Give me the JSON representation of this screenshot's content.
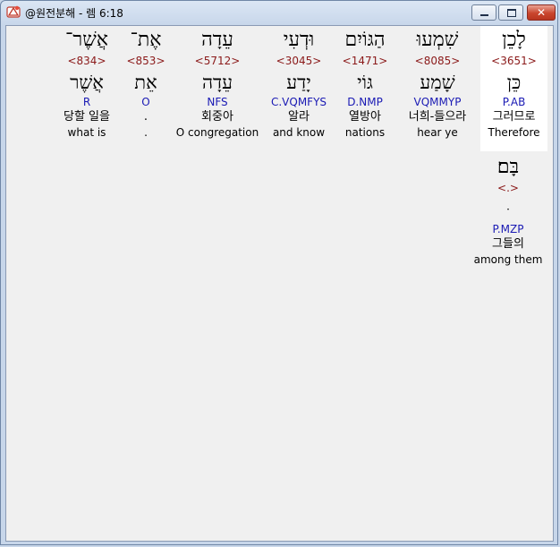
{
  "window": {
    "title": "@원전분해 - 렘 6:18",
    "close_glyph": "✕"
  },
  "words": [
    {
      "hebrew": "לָכֵן",
      "strong": "<3651>",
      "lemma": "כֵּן",
      "morph": "P.AB",
      "korean": "그러므로",
      "english": "Therefore",
      "selected": true
    },
    {
      "hebrew": "שִׁמְעוּ",
      "strong": "<8085>",
      "lemma": "שָׁמַע",
      "morph": "VQMMYP",
      "korean": "너희-들으라",
      "english": "hear ye",
      "selected": false
    },
    {
      "hebrew": "הַגּוֹיִם",
      "strong": "<1471>",
      "lemma": "גּוֹי",
      "morph": "D.NMP",
      "korean": "열방아",
      "english": "nations",
      "selected": false
    },
    {
      "hebrew": "וּדְעִי",
      "strong": "<3045>",
      "lemma": "יָדַע",
      "morph": "C.VQMFYS",
      "korean": "알라",
      "english": "and know",
      "selected": false
    },
    {
      "hebrew": "עֵדָה",
      "strong": "<5712>",
      "lemma": "עֵדָה",
      "morph": "NFS",
      "korean": "회중아",
      "english": "O congregation",
      "selected": false
    },
    {
      "hebrew": "אֶת־",
      "strong": "<853>",
      "lemma": "אֵת",
      "morph": "O",
      "korean": ".",
      "english": ".",
      "selected": false
    },
    {
      "hebrew": "אֲשֶׁר־",
      "strong": "<834>",
      "lemma": "אֲשֶׁר",
      "morph": "R",
      "korean": "당할 일을",
      "english": "what is",
      "selected": false
    },
    {
      "hebrew": "בָּם׃",
      "strong": "<.>",
      "lemma": "ּ",
      "morph": "P.MZP",
      "korean": "그들의",
      "english": "among them",
      "selected": false
    }
  ]
}
